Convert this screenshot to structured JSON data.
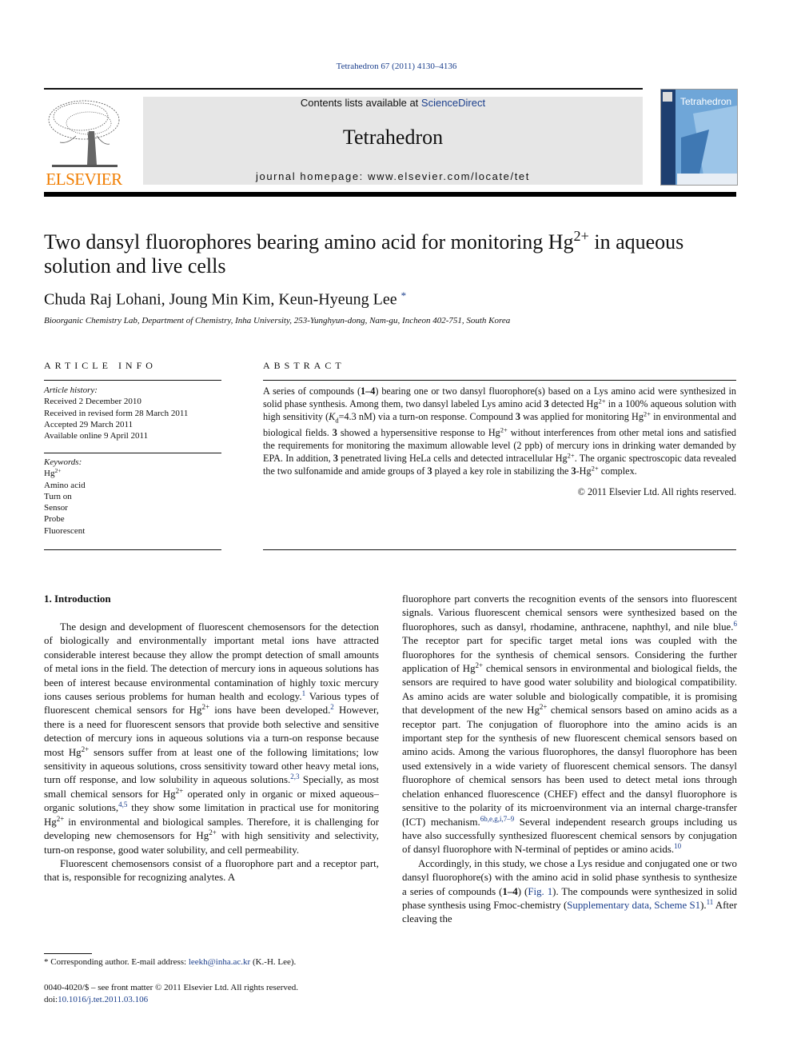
{
  "citation": "Tetrahedron 67 (2011) 4130–4136",
  "header": {
    "publisher_logo_text": "ELSEVIER",
    "contents_prefix": "Contents lists available at ",
    "contents_link": "ScienceDirect",
    "journal_name": "Tetrahedron",
    "homepage": "journal homepage: www.elsevier.com/locate/tet",
    "cover_title": "Tetrahedron"
  },
  "colors": {
    "link": "#1a3e8c",
    "elsevier_orange": "#f07d00",
    "banner_bg": "#e6e6e6",
    "cover_blue": "#4a86c0"
  },
  "article": {
    "title_part1": "Two dansyl fluorophores bearing amino acid for monitoring Hg",
    "title_sup": "2+",
    "title_part2": " in aqueous solution and live cells",
    "authors": "Chuda Raj Lohani, Joung Min Kim, Keun-Hyeung Lee",
    "corresponding_mark": "*",
    "affiliation": "Bioorganic Chemistry Lab, Department of Chemistry, Inha University, 253-Yunghyun-dong, Nam-gu, Incheon 402-751, South Korea"
  },
  "article_info": {
    "heading": "ARTICLE INFO",
    "history_label": "Article history:",
    "history": [
      "Received 2 December 2010",
      "Received in revised form 28 March 2011",
      "Accepted 29 March 2011",
      "Available online 9 April 2011"
    ],
    "keywords_label": "Keywords:",
    "keyword_hg": "Hg",
    "keyword_hg_sup": "2+",
    "keywords": [
      "Amino acid",
      "Turn on",
      "Sensor",
      "Probe",
      "Fluorescent"
    ]
  },
  "abstract": {
    "heading": "ABSTRACT",
    "s1": "A series of compounds (",
    "s1_bold": "1–4",
    "s2": ") bearing one or two dansyl fluorophore(s) based on a Lys amino acid were synthesized in solid phase synthesis. Among them, two dansyl labeled Lys amino acid ",
    "b3": "3",
    "s3": " detected Hg",
    "sup": "2+",
    "s4": " in a 100% aqueous solution with high sensitivity (",
    "kd": "K",
    "kd_sub": "d",
    "s5": "=4.3 nM) via a turn-on response. Compound ",
    "s6": " was applied for monitoring Hg",
    "s7": " in environmental and biological fields. ",
    "s8": " showed a hypersensitive response to Hg",
    "s9": " without interferences from other metal ions and satisfied the requirements for monitoring the maximum allowable level (2 ppb) of mercury ions in drinking water demanded by EPA. In addition, ",
    "s10": " penetrated living HeLa cells and detected intracellular Hg",
    "s11": ". The organic spectroscopic data revealed the two sulfonamide and amide groups of ",
    "s12": " played a key role in stabilizing the ",
    "s13": "-Hg",
    "s14": " complex.",
    "copyright": "© 2011 Elsevier Ltd. All rights reserved."
  },
  "introduction": {
    "heading": "1.  Introduction",
    "left_col": {
      "p1_a": "The design and development of fluorescent chemosensors for the detection of biologically and environmentally important metal ions have attracted considerable interest because they allow the prompt detection of small amounts of metal ions in the field. The detection of mercury ions in aqueous solutions has been of interest because environmental contamination of highly toxic mercury ions causes serious problems for human health and ecology.",
      "ref1": "1",
      "p1_b": " Various types of fluorescent chemical sensors for Hg",
      "p1_c": " ions have been developed.",
      "ref2": "2",
      "p1_d": " However, there is a need for fluorescent sensors that provide both selective and sensitive detection of mercury ions in aqueous solutions via a turn-on response because most Hg",
      "p1_e": " sensors suffer from at least one of the following limitations; low sensitivity in aqueous solutions, cross sensitivity toward other heavy metal ions, turn off response, and low solubility in aqueous solutions.",
      "ref23": "2,3",
      "p1_f": " Specially, as most small chemical sensors for Hg",
      "p1_g": " operated only in organic or mixed aqueous–organic solutions,",
      "ref45": "4,5",
      "p1_h": " they show some limitation in practical use for monitoring Hg",
      "p1_i": " in environmental and biological samples. Therefore, it is challenging for developing new chemosensors for Hg",
      "p1_j": " with high sensitivity and selectivity, turn-on response, good water solubility, and cell permeability.",
      "p2": "Fluorescent chemosensors consist of a fluorophore part and a receptor part, that is, responsible for recognizing analytes. A"
    },
    "right_col": {
      "p1_a": "fluorophore part converts the recognition events of the sensors into fluorescent signals. Various fluorescent chemical sensors were synthesized based on the fluorophores, such as dansyl, rhodamine, anthracene, naphthyl, and nile blue.",
      "ref6": "6",
      "p1_b": " The receptor part for specific target metal ions was coupled with the fluorophores for the synthesis of chemical sensors. Considering the further application of Hg",
      "p1_c": " chemical sensors in environmental and biological fields, the sensors are required to have good water solubility and biological compatibility. As amino acids are water soluble and biologically compatible, it is promising that development of the new Hg",
      "p1_d": " chemical sensors based on amino acids as a receptor part. The conjugation of fluorophore into the amino acids is an important step for the synthesis of new fluorescent chemical sensors based on amino acids. Among the various fluorophores, the dansyl fluorophore has been used extensively in a wide variety of fluorescent chemical sensors. The dansyl fluorophore of chemical sensors has been used to detect metal ions through chelation enhanced fluorescence (CHEF) effect and the dansyl fluorophore is sensitive to the polarity of its microenvironment via an internal charge-transfer (ICT) mechanism.",
      "ref6b": "6b,e,g,i,7–9",
      "p1_e": " Several independent research groups including us have also successfully synthesized fluorescent chemical sensors by conjugation of dansyl fluorophore with N-terminal of peptides or amino acids.",
      "ref10": "10",
      "p2_a": "Accordingly, in this study, we chose a Lys residue and conjugated one or two dansyl fluorophore(s) with the amino acid in solid phase synthesis to synthesize a series of compounds (",
      "p2_bold": "1–4",
      "p2_b": ") (",
      "fig_link": "Fig. 1",
      "p2_c": "). The compounds were synthesized in solid phase synthesis using Fmoc-chemistry (",
      "supp_link": "Supplementary data, Scheme S1",
      "p2_d": ").",
      "ref11": "11",
      "p2_e": " After cleaving the"
    }
  },
  "footnote": {
    "text_a": "* Corresponding author. E-mail address: ",
    "email": "leekh@inha.ac.kr",
    "text_b": " (K.-H. Lee)."
  },
  "frontmatter": {
    "line1": "0040-4020/$ – see front matter © 2011 Elsevier Ltd. All rights reserved.",
    "doi_prefix": "doi:",
    "doi": "10.1016/j.tet.2011.03.106"
  }
}
